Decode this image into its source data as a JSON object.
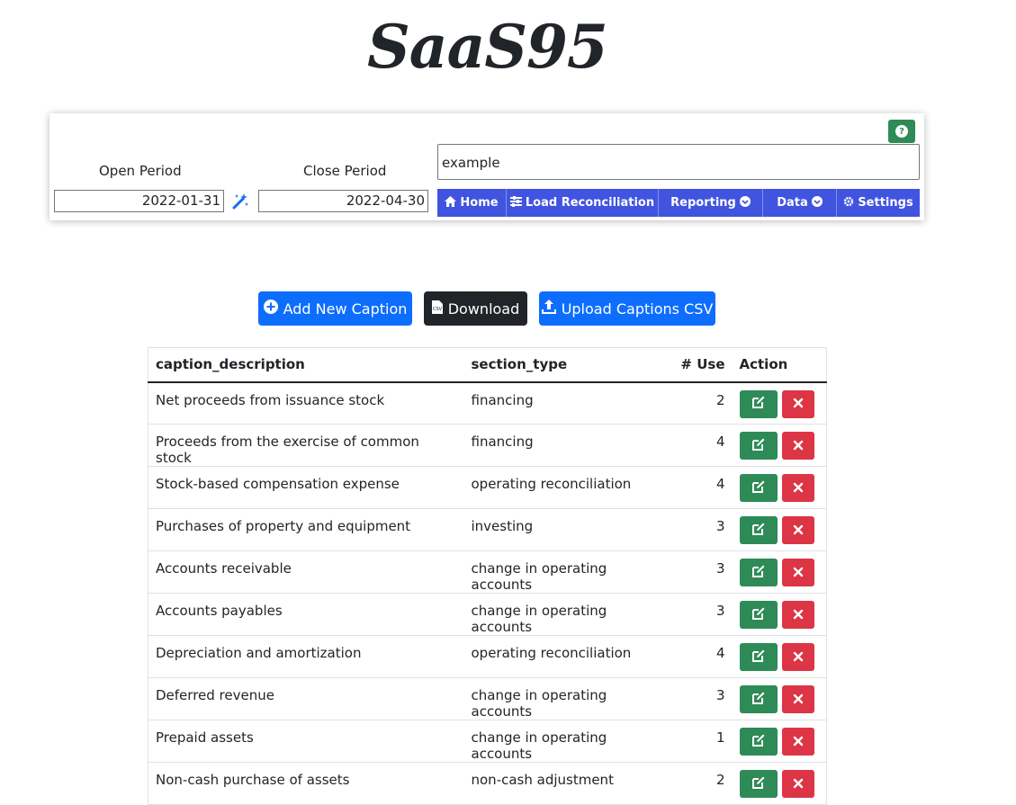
{
  "app": {
    "logo": "SaaS95"
  },
  "filters": {
    "open_period_label": "Open Period",
    "close_period_label": "Close Period",
    "open_period_value": "2022-01-31",
    "close_period_value": "2022-04-30",
    "company_value": "example"
  },
  "nav": {
    "home": "Home",
    "load_reconciliation": "Load Reconciliation",
    "reporting": "Reporting",
    "data": "Data",
    "settings": "Settings"
  },
  "actions": {
    "add_new_caption": "Add New Caption",
    "download": "Download",
    "upload_captions_csv": "Upload Captions CSV"
  },
  "table": {
    "headers": {
      "caption_description": "caption_description",
      "section_type": "section_type",
      "use": "# Use",
      "action": "Action"
    },
    "rows": [
      {
        "caption_description": "Net proceeds from issuance stock",
        "section_type": "financing",
        "use": "2"
      },
      {
        "caption_description": "Proceeds from the exercise of common stock",
        "section_type": "financing",
        "use": "4"
      },
      {
        "caption_description": "Stock-based compensation expense",
        "section_type": "operating reconciliation",
        "use": "4"
      },
      {
        "caption_description": "Purchases of property and equipment",
        "section_type": "investing",
        "use": "3"
      },
      {
        "caption_description": "Accounts receivable",
        "section_type": "change in operating accounts",
        "use": "3"
      },
      {
        "caption_description": "Accounts payables",
        "section_type": "change in operating accounts",
        "use": "3"
      },
      {
        "caption_description": "Depreciation and amortization",
        "section_type": "operating reconciliation",
        "use": "4"
      },
      {
        "caption_description": "Deferred revenue",
        "section_type": "change in operating accounts",
        "use": "3"
      },
      {
        "caption_description": "Prepaid assets",
        "section_type": "change in operating accounts",
        "use": "1"
      },
      {
        "caption_description": "Non-cash purchase of assets",
        "section_type": "non-cash adjustment",
        "use": "2"
      }
    ]
  },
  "colors": {
    "nav_bg": "#4154e0",
    "primary": "#0d6efd",
    "dark": "#212529",
    "success": "#2e8b57",
    "danger": "#dc3545"
  },
  "icons": {
    "help": "question-circle-icon",
    "wand": "magic-wand-icon",
    "home": "home-icon",
    "load": "sliders-icon",
    "dropdown": "chevron-circle-down-icon",
    "settings": "gear-icon",
    "add": "plus-circle-icon",
    "download": "csv-file-icon",
    "upload": "upload-icon",
    "edit": "edit-icon",
    "delete": "x-icon"
  }
}
